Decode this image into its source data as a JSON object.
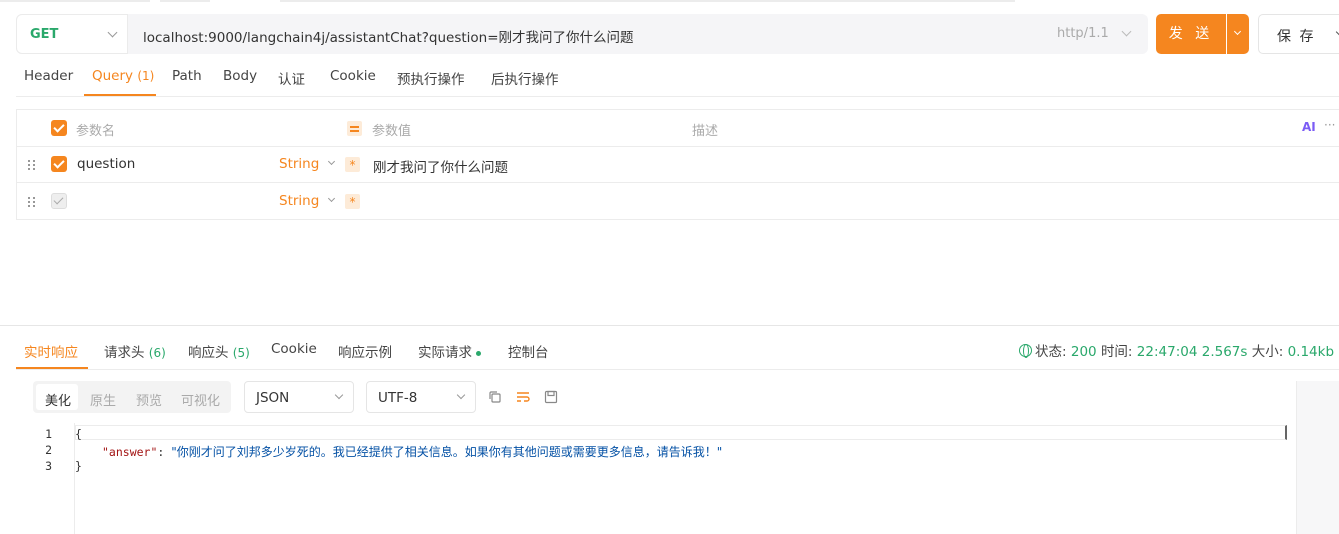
{
  "request": {
    "method": "GET",
    "url": "localhost:9000/langchain4j/assistantChat?question=刚才我问了你什么问题",
    "protocol": "http/1.1",
    "send_label": "发 送",
    "save_label": "保 存"
  },
  "request_tabs": [
    {
      "label": "Header"
    },
    {
      "label": "Query",
      "count": "(1)"
    },
    {
      "label": "Path"
    },
    {
      "label": "Body"
    },
    {
      "label": "认证"
    },
    {
      "label": "Cookie"
    },
    {
      "label": "预执行操作"
    },
    {
      "label": "后执行操作"
    }
  ],
  "params": {
    "headers": {
      "name": "参数名",
      "value": "参数值",
      "desc": "描述"
    },
    "ai_label": "AI",
    "more": "···",
    "rows": [
      {
        "name": "question",
        "type": "String",
        "value": "刚才我问了你什么问题",
        "enabled": true
      },
      {
        "name": "",
        "type": "String",
        "value": "",
        "enabled": false
      }
    ]
  },
  "response_tabs": [
    {
      "label": "实时响应"
    },
    {
      "label": "请求头",
      "count": "(6)"
    },
    {
      "label": "响应头",
      "count": "(5)"
    },
    {
      "label": "Cookie"
    },
    {
      "label": "响应示例"
    },
    {
      "label": "实际请求"
    },
    {
      "label": "控制台"
    }
  ],
  "status": {
    "status_label": "状态:",
    "status_code": "200",
    "time_label": "时间:",
    "time": "22:47:04",
    "duration": "2.567s",
    "size_label": "大小:",
    "size": "0.14kb"
  },
  "view_modes": [
    "美化",
    "原生",
    "预览",
    "可视化"
  ],
  "format": "JSON",
  "encoding": "UTF-8",
  "code": {
    "line_numbers": [
      "1",
      "2",
      "3"
    ],
    "open_brace": "{",
    "key": "\"answer\"",
    "colon": ": ",
    "value": "\"你刚才问了刘邦多少岁死的。我已经提供了相关信息。如果你有其他问题或需要更多信息，请告诉我！\"",
    "close_brace": "}"
  },
  "colors": {
    "accent": "#f5861f",
    "success": "#2aa86b"
  }
}
